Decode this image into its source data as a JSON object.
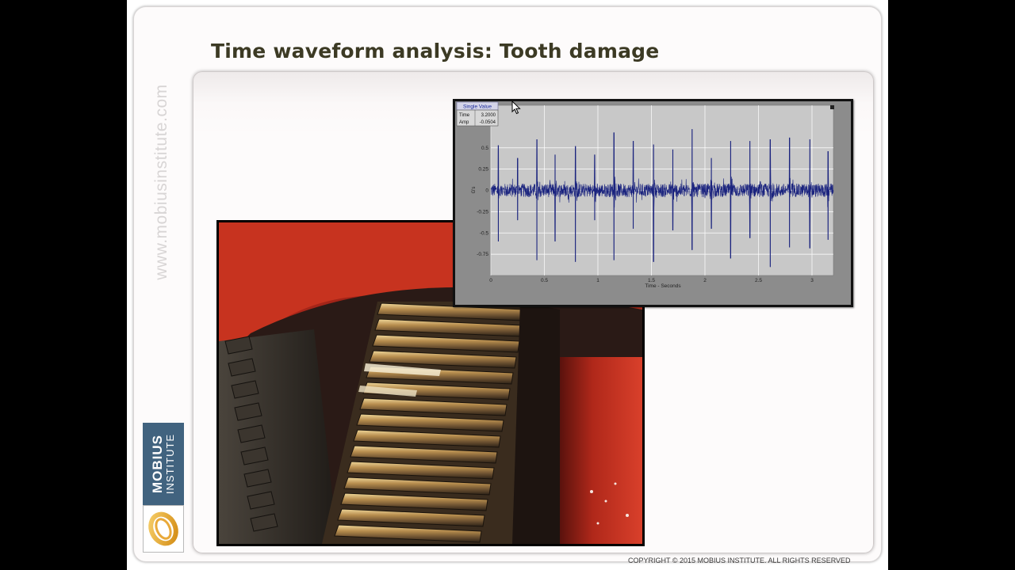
{
  "slide": {
    "title": "Time waveform analysis: Tooth damage",
    "watermark": "www.mobiusinstitute.com",
    "logo": {
      "line1": "MOBIUS",
      "line2": "INSTITUTE"
    },
    "copyright": "COPYRIGHT © 2015  MOBIUS INSTITUTE.  ALL RIGHTS RESERVED"
  },
  "readout": {
    "title": "Single Value",
    "time_label": "Time",
    "time_value": "3.2000",
    "amp_label": "Amp",
    "amp_value": "-0.0504"
  },
  "chart_data": {
    "type": "line",
    "title": "",
    "xlabel": "Time - Seconds",
    "ylabel": "G's",
    "xlim": [
      0,
      3.2
    ],
    "ylim": [
      -1,
      1
    ],
    "xticks": [
      "0",
      "0.5",
      "1",
      "1.5",
      "2",
      "2.5",
      "3"
    ],
    "yticks": [
      "0.5",
      "0.25",
      "0",
      "-0.25",
      "-0.5",
      "-0.75"
    ],
    "grid": true,
    "series": [
      {
        "color": "#1a237e",
        "baseline_amplitude": 0.08,
        "impacts": [
          {
            "t": 0.07,
            "peak": 0.53,
            "trough": -0.6
          },
          {
            "t": 0.25,
            "peak": 0.38,
            "trough": -0.35
          },
          {
            "t": 0.43,
            "peak": 0.6,
            "trough": -0.82
          },
          {
            "t": 0.6,
            "peak": 0.42,
            "trough": -0.6
          },
          {
            "t": 0.79,
            "peak": 0.52,
            "trough": -0.84
          },
          {
            "t": 0.97,
            "peak": 0.42,
            "trough": -0.35
          },
          {
            "t": 1.15,
            "peak": 0.68,
            "trough": -0.82
          },
          {
            "t": 1.33,
            "peak": 0.58,
            "trough": -0.45
          },
          {
            "t": 1.52,
            "peak": 0.54,
            "trough": -0.84
          },
          {
            "t": 1.7,
            "peak": 0.48,
            "trough": -0.47
          },
          {
            "t": 1.88,
            "peak": 0.72,
            "trough": -0.7
          },
          {
            "t": 2.06,
            "peak": 0.38,
            "trough": -0.45
          },
          {
            "t": 2.24,
            "peak": 0.58,
            "trough": -0.8
          },
          {
            "t": 2.42,
            "peak": 0.58,
            "trough": -0.56
          },
          {
            "t": 2.61,
            "peak": 0.6,
            "trough": -0.9
          },
          {
            "t": 2.79,
            "peak": 0.62,
            "trough": -0.67
          },
          {
            "t": 2.98,
            "peak": 0.6,
            "trough": -0.68
          },
          {
            "t": 3.15,
            "peak": 0.46,
            "trough": -0.58
          }
        ]
      }
    ]
  },
  "colors": {
    "title": "#3c3a24",
    "logo_blue": "#41637f",
    "plot_bg": "#c8c8c8",
    "grid": "#ffffff",
    "trace": "#1a237e",
    "frame": "#8c8c8c"
  },
  "icons": {
    "cursor": "mouse-pointer-icon",
    "logo": "mobius-logo-icon"
  }
}
